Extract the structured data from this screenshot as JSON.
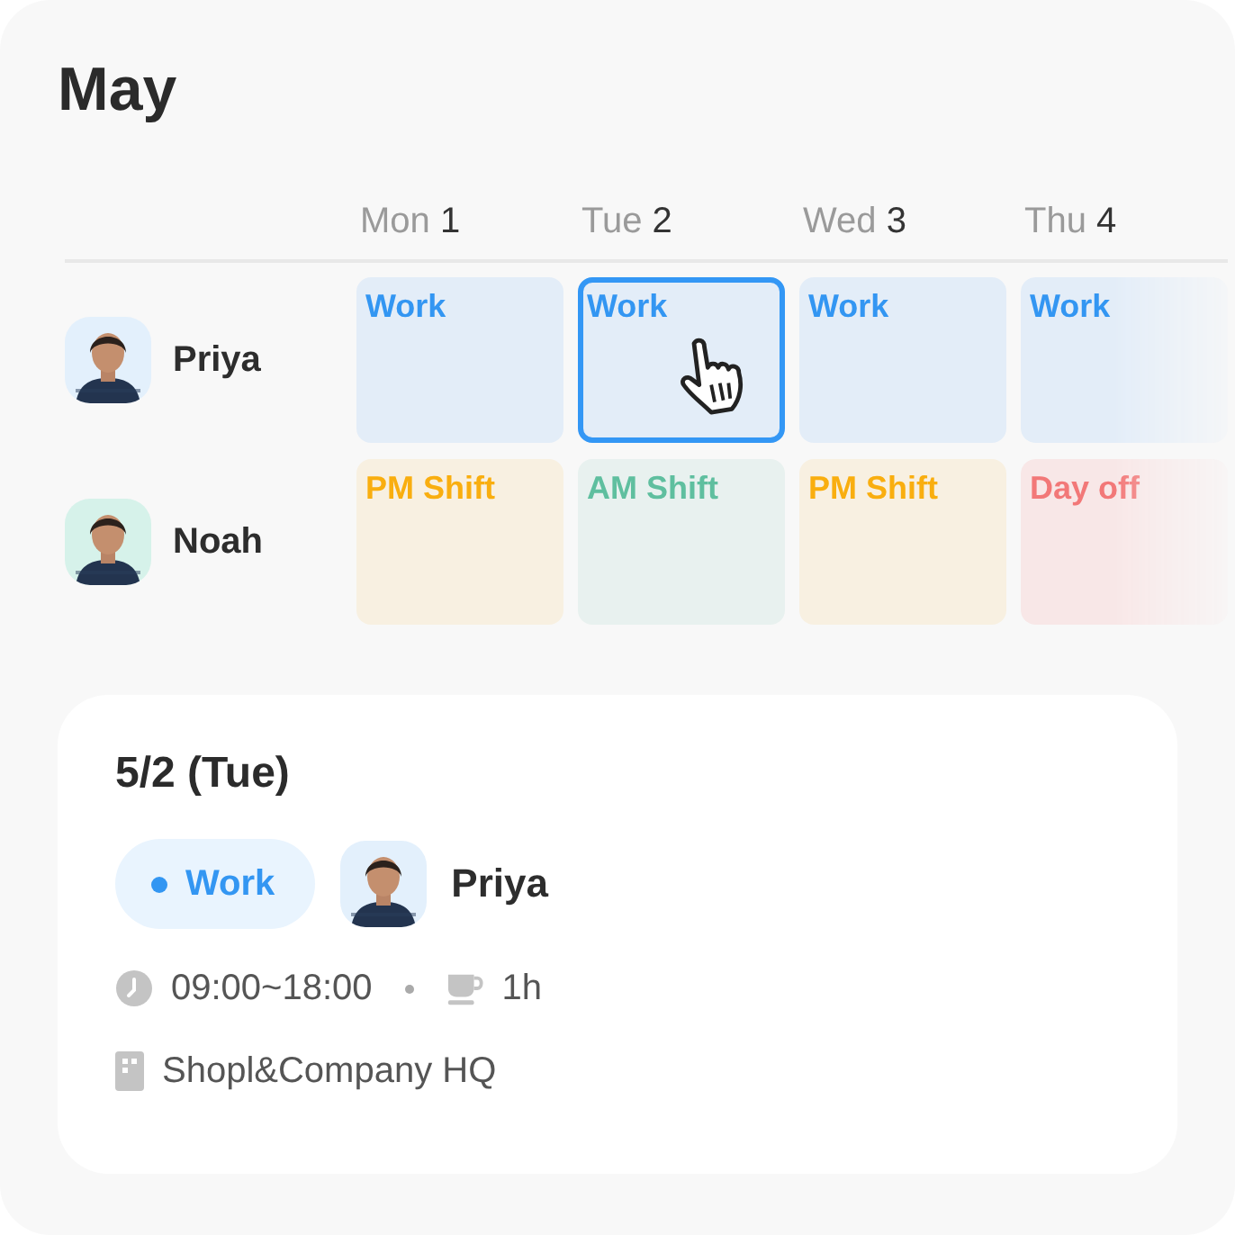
{
  "title": "May",
  "days": [
    {
      "weekday": "Mon",
      "date": "1"
    },
    {
      "weekday": "Tue",
      "date": "2"
    },
    {
      "weekday": "Wed",
      "date": "3"
    },
    {
      "weekday": "Thu",
      "date": "4"
    }
  ],
  "people": [
    {
      "name": "Priya",
      "color": "#e3f0fc",
      "shifts": [
        {
          "label": "Work",
          "kind": "work",
          "selected": false
        },
        {
          "label": "Work",
          "kind": "work",
          "selected": true
        },
        {
          "label": "Work",
          "kind": "work",
          "selected": false
        },
        {
          "label": "Work",
          "kind": "work",
          "selected": false
        }
      ]
    },
    {
      "name": "Noah",
      "color": "#d6f2ea",
      "shifts": [
        {
          "label": "PM Shift",
          "kind": "pm",
          "selected": false
        },
        {
          "label": "AM Shift",
          "kind": "am",
          "selected": false
        },
        {
          "label": "PM Shift",
          "kind": "pm",
          "selected": false
        },
        {
          "label": "Day off",
          "kind": "off",
          "selected": false
        }
      ]
    }
  ],
  "detail": {
    "date": "5/2 (Tue)",
    "tag": {
      "label": "Work",
      "kind": "work"
    },
    "person": {
      "name": "Priya",
      "color": "#e3f0fc"
    },
    "time": "09:00~18:00",
    "break": "1h",
    "location": "Shopl&Company HQ"
  }
}
